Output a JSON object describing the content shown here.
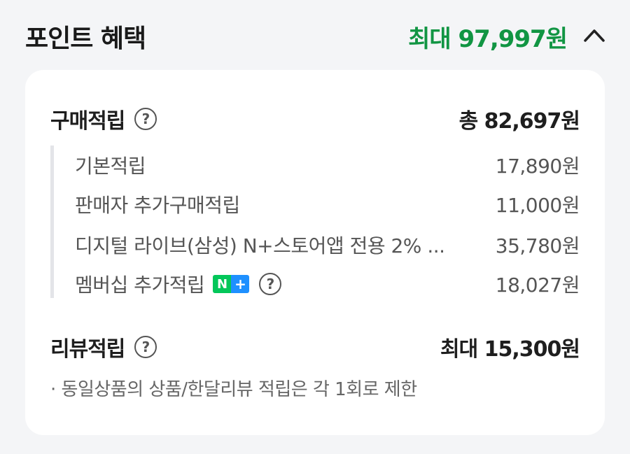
{
  "header": {
    "title": "포인트 혜택",
    "max_amount": "최대 97,997원",
    "accent_color": "#119543"
  },
  "purchase": {
    "label": "구매적립",
    "total": "총 82,697원",
    "items": [
      {
        "label": "기본적립",
        "value": "17,890원"
      },
      {
        "label": "판매자 추가구매적립",
        "value": "11,000원"
      },
      {
        "label": "디지털 라이브(삼성) N+스토어앱 전용 2% ...",
        "value": "35,780원"
      },
      {
        "label": "멤버십 추가적립",
        "value": "18,027원",
        "badge_n": "N",
        "badge_plus": "+"
      }
    ]
  },
  "review": {
    "label": "리뷰적립",
    "value": "최대 15,300원",
    "note": "· 동일상품의 상품/한달리뷰 적립은 각 1회로 제한"
  },
  "icons": {
    "help": "?",
    "collapse": "chevron-up-icon"
  }
}
